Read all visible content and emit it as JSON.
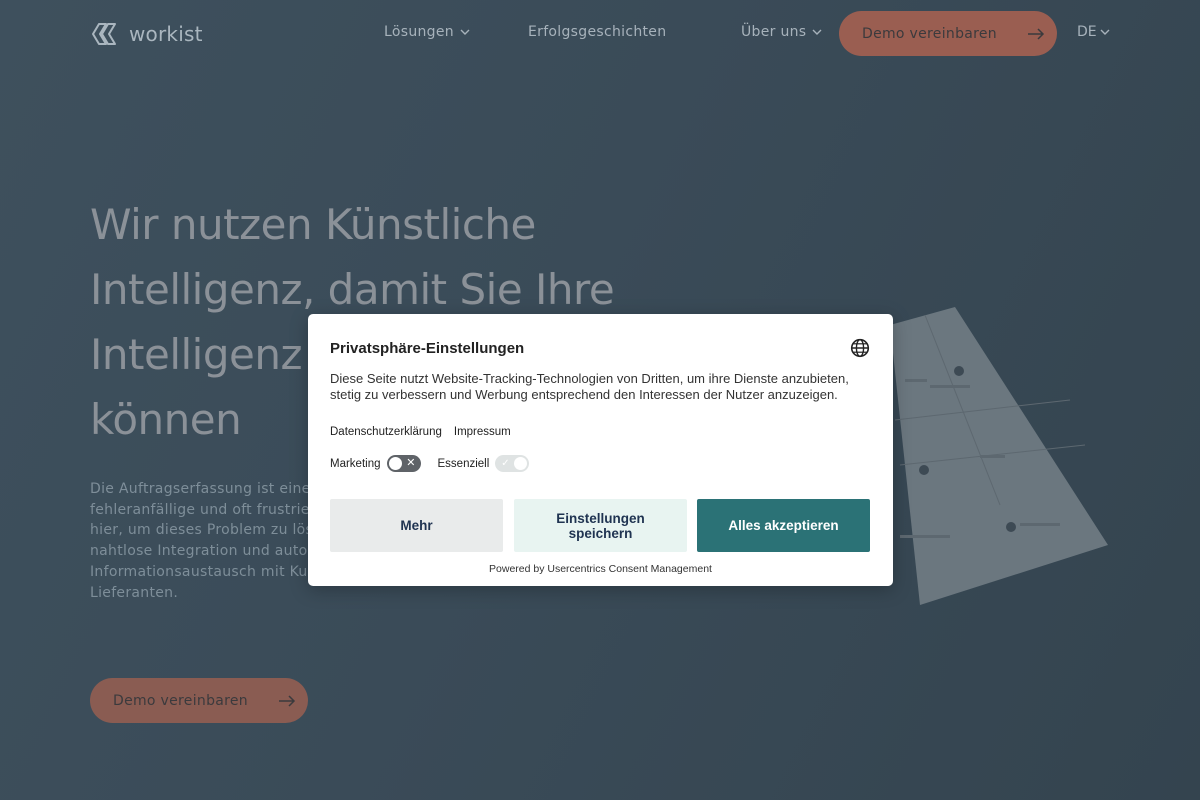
{
  "nav": {
    "logo_text": "workist",
    "items": [
      {
        "label": "Lösungen",
        "has_dropdown": true
      },
      {
        "label": "Erfolgsgeschichten",
        "has_dropdown": false
      },
      {
        "label": "Über uns",
        "has_dropdown": true
      }
    ],
    "cta_label": "Demo vereinbaren",
    "language": "DE"
  },
  "hero": {
    "title_lines": [
      "Wir nutzen Künstliche",
      "Intelligenz, damit Sie Ihre",
      "Intelligenz b",
      "können"
    ],
    "text_lines": [
      "Die Auftragserfassung ist eine",
      "fehleranfällige und oft frustrie",
      "hier, um dieses Problem zu lös",
      "nahtlose Integration und autom",
      "Informationsaustausch mit Ku",
      "Lieferanten."
    ],
    "cta_label": "Demo vereinbaren"
  },
  "consent": {
    "title": "Privatsphäre-Einstellungen",
    "description": "Diese Seite nutzt Website-Tracking-Technologien von Dritten, um ihre Dienste anzubieten, stetig zu verbessern und Werbung entsprechend den Interessen der Nutzer anzuzeigen.",
    "links": {
      "privacy": "Datenschutzerklärung",
      "imprint": "Impressum"
    },
    "toggles": [
      {
        "label": "Marketing",
        "enabled": false
      },
      {
        "label": "Essenziell",
        "enabled": true,
        "locked": true
      }
    ],
    "buttons": {
      "more": "Mehr",
      "save": "Einstellungen speichern",
      "accept": "Alles akzeptieren"
    },
    "powered_by": "Powered by Usercentrics Consent Management"
  },
  "colors": {
    "background": "#3d4e5b",
    "cta": "#9a5e51",
    "accept_button": "#2b7276",
    "save_button": "#e8f4f1",
    "more_button": "#e9ebeb"
  },
  "icons": [
    "workist-logo-icon",
    "chevron-down-icon",
    "arrow-right-icon",
    "globe-icon",
    "close-x-icon",
    "check-icon"
  ]
}
